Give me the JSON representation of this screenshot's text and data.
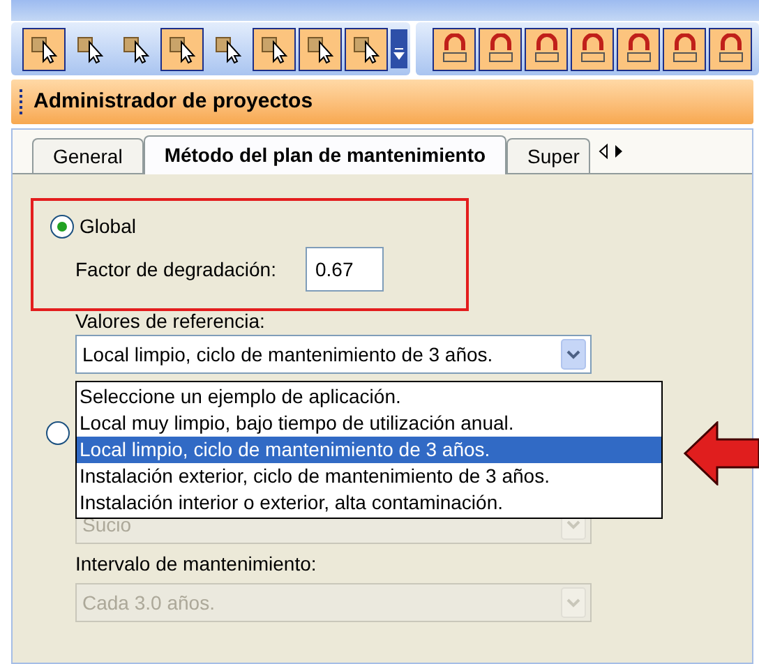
{
  "toolbars": [
    {
      "buttons": [
        {
          "selected": true
        },
        {
          "selected": false
        },
        {
          "selected": false
        },
        {
          "selected": true
        },
        {
          "selected": false
        },
        {
          "selected": true
        },
        {
          "selected": true
        },
        {
          "selected": true
        }
      ]
    },
    {
      "buttons": [
        {
          "selected": true
        },
        {
          "selected": true
        },
        {
          "selected": true
        },
        {
          "selected": true
        },
        {
          "selected": true
        },
        {
          "selected": true
        },
        {
          "selected": true
        }
      ]
    }
  ],
  "panel": {
    "title": "Administrador de proyectos"
  },
  "tabs": [
    {
      "label": "General",
      "selected": false
    },
    {
      "label": "Método del plan de mantenimiento",
      "selected": true
    },
    {
      "label": "Super",
      "selected": false
    }
  ],
  "global_option": {
    "label": "Global",
    "selected": true
  },
  "degradation_factor": {
    "label": "Factor de degradación:",
    "value": "0.67"
  },
  "reference_values": {
    "label": "Valores de referencia:",
    "value": "Local limpio, ciclo de mantenimiento de 3 años.",
    "options": [
      {
        "label": "Seleccione un ejemplo de aplicación.",
        "selected": false
      },
      {
        "label": "Local muy limpio, bajo tiempo de utilización anual.",
        "selected": false
      },
      {
        "label": "Local limpio, ciclo de mantenimiento de 3 años.",
        "selected": true
      },
      {
        "label": "Instalación exterior, ciclo de mantenimiento de 3 años.",
        "selected": false
      },
      {
        "label": "Instalación interior o exterior, alta contaminación.",
        "selected": false
      }
    ]
  },
  "custom_option": {
    "selected": false
  },
  "pollution": {
    "value": "Sucio",
    "disabled": true
  },
  "interval": {
    "label": "Intervalo de mantenimiento:",
    "value": "Cada 3.0 años.",
    "disabled": true
  }
}
